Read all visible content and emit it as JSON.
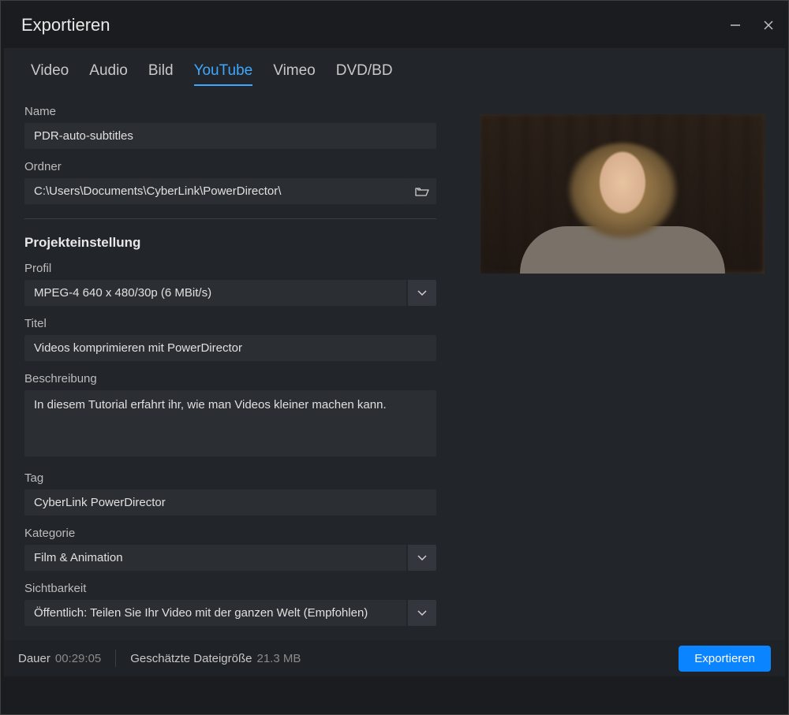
{
  "window": {
    "title": "Exportieren"
  },
  "tabs": {
    "video": "Video",
    "audio": "Audio",
    "bild": "Bild",
    "youtube": "YouTube",
    "vimeo": "Vimeo",
    "dvdbd": "DVD/BD"
  },
  "form": {
    "name_label": "Name",
    "name_value": "PDR-auto-subtitles",
    "folder_label": "Ordner",
    "folder_value": "C:\\Users\\Documents\\CyberLink\\PowerDirector\\",
    "section_heading": "Projekteinstellung",
    "profile_label": "Profil",
    "profile_value": "MPEG-4 640 x 480/30p (6 MBit/s)",
    "title_label": "Titel",
    "title_value": "Videos komprimieren mit PowerDirector",
    "desc_label": "Beschreibung",
    "desc_value": "In diesem Tutorial erfahrt ihr, wie man Videos kleiner machen kann.",
    "tag_label": "Tag",
    "tag_value": "CyberLink PowerDirector",
    "category_label": "Kategorie",
    "category_value": "Film & Animation",
    "visibility_label": "Sichtbarkeit",
    "visibility_value": "Öffentlich: Teilen Sie Ihr Video mit der ganzen Welt (Empfohlen)"
  },
  "footer": {
    "duration_label": "Dauer",
    "duration_value": "00:29:05",
    "size_label": "Geschätzte Dateigröße",
    "size_value": "21.3 MB",
    "export_button": "Exportieren"
  }
}
